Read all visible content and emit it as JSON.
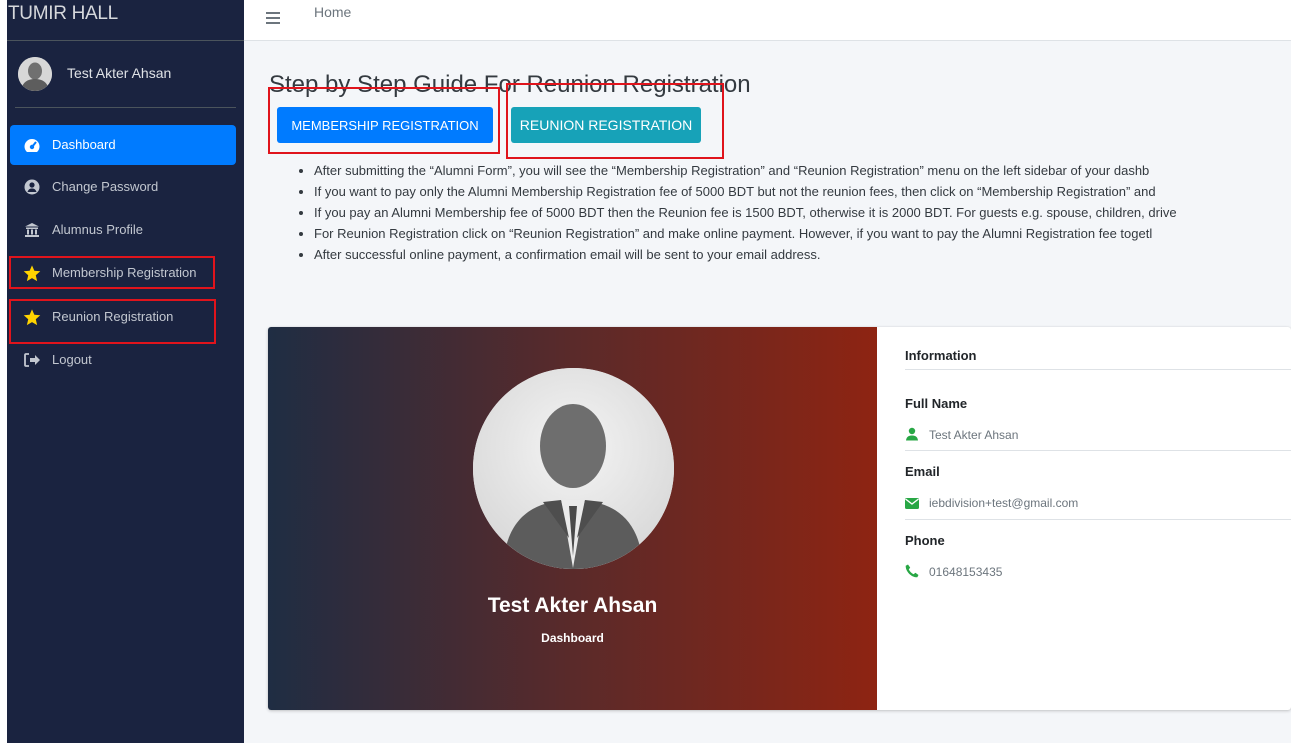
{
  "sidebar": {
    "brand": "ITUMIR HALL",
    "user_name": "Test Akter Ahsan",
    "items": [
      {
        "label": "Dashboard",
        "icon": "gauge-icon",
        "active": true
      },
      {
        "label": "Change Password",
        "icon": "user-circle-icon"
      },
      {
        "label": "Alumnus Profile",
        "icon": "building-icon"
      },
      {
        "label": "Membership Registration",
        "icon": "star-icon"
      },
      {
        "label": "Reunion Registration",
        "icon": "star-icon"
      },
      {
        "label": "Logout",
        "icon": "sign-out-icon"
      }
    ]
  },
  "topbar": {
    "home": "Home"
  },
  "main": {
    "title": "Step by Step Guide For Reunion Registration",
    "membership_button": "MEMBERSHIP REGISTRATION",
    "reunion_button": "REUNION REGISTRATION",
    "bullets": [
      "After submitting the “Alumni Form”, you will see the “Membership Registration” and “Reunion Registration” menu on the left sidebar of your dashb",
      "If you want to pay only the Alumni Membership Registration fee of 5000 BDT but not the reunion fees, then click on “Membership Registration” and",
      "If you pay an Alumni Membership fee of 5000 BDT then the Reunion fee is 1500 BDT, otherwise it is 2000 BDT. For guests e.g. spouse, children, drive",
      "For Reunion Registration click on “Reunion Registration” and make online payment. However, if you want to pay the Alumni Registration fee togetl",
      "After successful online payment, a confirmation email will be sent to your email address."
    ]
  },
  "profile": {
    "name": "Test Akter Ahsan",
    "subtitle": "Dashboard",
    "info_heading": "Information",
    "full_name_label": "Full Name",
    "full_name": "Test Akter Ahsan",
    "email_label": "Email",
    "email": "iebdivision+test@gmail.com",
    "phone_label": "Phone",
    "phone": "01648153435"
  },
  "colors": {
    "sidebar_bg": "#1a2340",
    "primary": "#007bff",
    "info": "#17a2b8",
    "highlight": "#e0141c",
    "star": "#ffd400",
    "success": "#28a745"
  }
}
